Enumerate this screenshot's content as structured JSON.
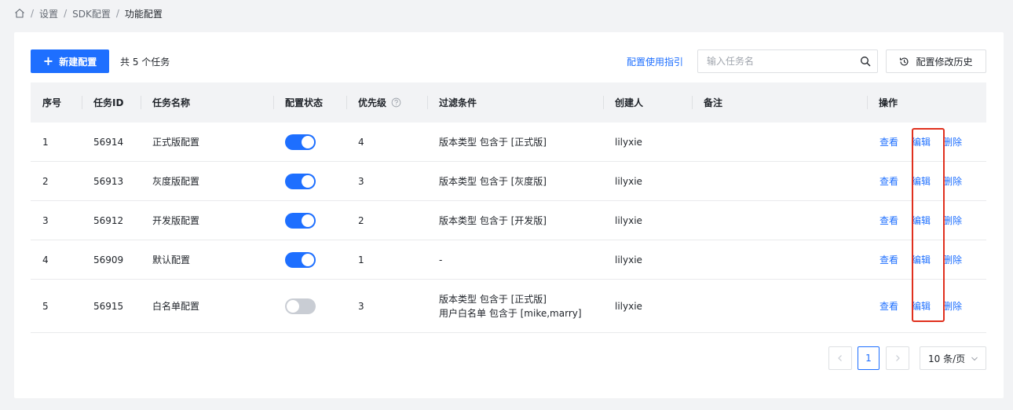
{
  "breadcrumb": {
    "items": [
      "设置",
      "SDK配置"
    ],
    "current": "功能配置"
  },
  "toolbar": {
    "new_label": "新建配置",
    "total_text": "共 5 个任务",
    "guide_link": "配置使用指引",
    "search_placeholder": "输入任务名",
    "history_label": "配置修改历史"
  },
  "table": {
    "headers": {
      "index": "序号",
      "task_id": "任务ID",
      "task_name": "任务名称",
      "status": "配置状态",
      "priority": "优先级",
      "filter": "过滤条件",
      "creator": "创建人",
      "remark": "备注",
      "actions": "操作"
    },
    "rows": [
      {
        "index": "1",
        "task_id": "56914",
        "task_name": "正式版配置",
        "enabled": true,
        "priority": "4",
        "filter": [
          "版本类型 包含于 [正式版]"
        ],
        "creator": "lilyxie",
        "remark": ""
      },
      {
        "index": "2",
        "task_id": "56913",
        "task_name": "灰度版配置",
        "enabled": true,
        "priority": "3",
        "filter": [
          "版本类型 包含于 [灰度版]"
        ],
        "creator": "lilyxie",
        "remark": ""
      },
      {
        "index": "3",
        "task_id": "56912",
        "task_name": "开发版配置",
        "enabled": true,
        "priority": "2",
        "filter": [
          "版本类型 包含于 [开发版]"
        ],
        "creator": "lilyxie",
        "remark": ""
      },
      {
        "index": "4",
        "task_id": "56909",
        "task_name": "默认配置",
        "enabled": true,
        "priority": "1",
        "filter": [
          "-"
        ],
        "creator": "lilyxie",
        "remark": ""
      },
      {
        "index": "5",
        "task_id": "56915",
        "task_name": "白名单配置",
        "enabled": false,
        "priority": "3",
        "filter": [
          "版本类型 包含于 [正式版]",
          "用户白名单 包含于 [mike,marry]"
        ],
        "creator": "lilyxie",
        "remark": ""
      }
    ],
    "actions": {
      "view": "查看",
      "edit": "编辑",
      "delete": "删除"
    }
  },
  "pagination": {
    "current_page": "1",
    "page_size_label": "10 条/页"
  },
  "colors": {
    "primary": "#1e6fff",
    "highlight": "#e0301e",
    "toggle_off": "#c9cdd4"
  }
}
